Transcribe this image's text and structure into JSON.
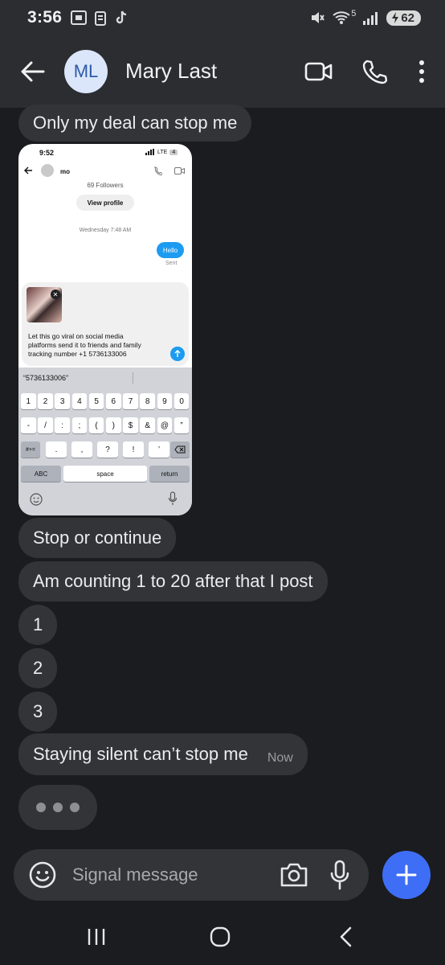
{
  "status_bar": {
    "time": "3:56",
    "wifi_label": "5",
    "battery": "62"
  },
  "header": {
    "avatar_initials": "ML",
    "contact_name": "Mary Last"
  },
  "messages": [
    {
      "text": "Only my deal can stop me"
    },
    {
      "text": "Stop or continue"
    },
    {
      "text": "Am counting 1 to 20 after that I post"
    },
    {
      "text": "1"
    },
    {
      "text": "2"
    },
    {
      "text": "3"
    },
    {
      "text": "Staying silent can’t stop me",
      "timestamp": "Now"
    }
  ],
  "screenshot": {
    "time": "9:52",
    "network": "LTE",
    "battery": "4",
    "user": "mo",
    "followers": "69 Followers",
    "view_profile": "View profile",
    "date": "Wednesday 7:48 AM",
    "sent_message": "Hello",
    "sent_status": "Sent",
    "draft_line1": "Let this go viral on social media",
    "draft_line2": "platforms send it to friends and family",
    "draft_line3": "tracking number +1 5736133006",
    "suggestion": "“5736133006”",
    "keys_row1": [
      "1",
      "2",
      "3",
      "4",
      "5",
      "6",
      "7",
      "8",
      "9",
      "0"
    ],
    "keys_row2": [
      "-",
      "/",
      ":",
      ";",
      "(",
      ")",
      "$",
      "&",
      "@",
      "”"
    ],
    "keys_row3": [
      ".",
      ",",
      "?",
      "!",
      "’"
    ],
    "key_symbols": "#+=",
    "key_abc": "ABC",
    "key_space": "space",
    "key_return": "return"
  },
  "composer": {
    "placeholder": "Signal message"
  },
  "colors": {
    "background": "#1b1c1f",
    "bar": "#2b2d31",
    "bubble": "#333438",
    "accent": "#3e6ef6",
    "avatar_bg": "#dbe6fb"
  }
}
